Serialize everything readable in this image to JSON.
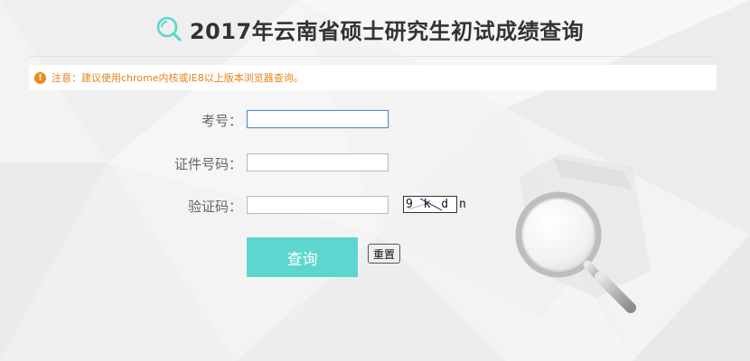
{
  "header": {
    "title": "2017年云南省硕士研究生初试成绩查询",
    "icon": "search-icon",
    "accent_color": "#5dd6d0"
  },
  "notice": {
    "icon": "exclamation-icon",
    "text": "注意：建议使用chrome内核或IE8以上版本浏览器查询。",
    "color": "#e8811a"
  },
  "form": {
    "exam_number_label": "考号：",
    "exam_number_value": "",
    "id_number_label": "证件号码：",
    "id_number_value": "",
    "captcha_label": "验证码：",
    "captcha_value": "",
    "captcha_image_text": "9 k d n"
  },
  "actions": {
    "submit_label": "查询",
    "reset_label": "重置"
  }
}
